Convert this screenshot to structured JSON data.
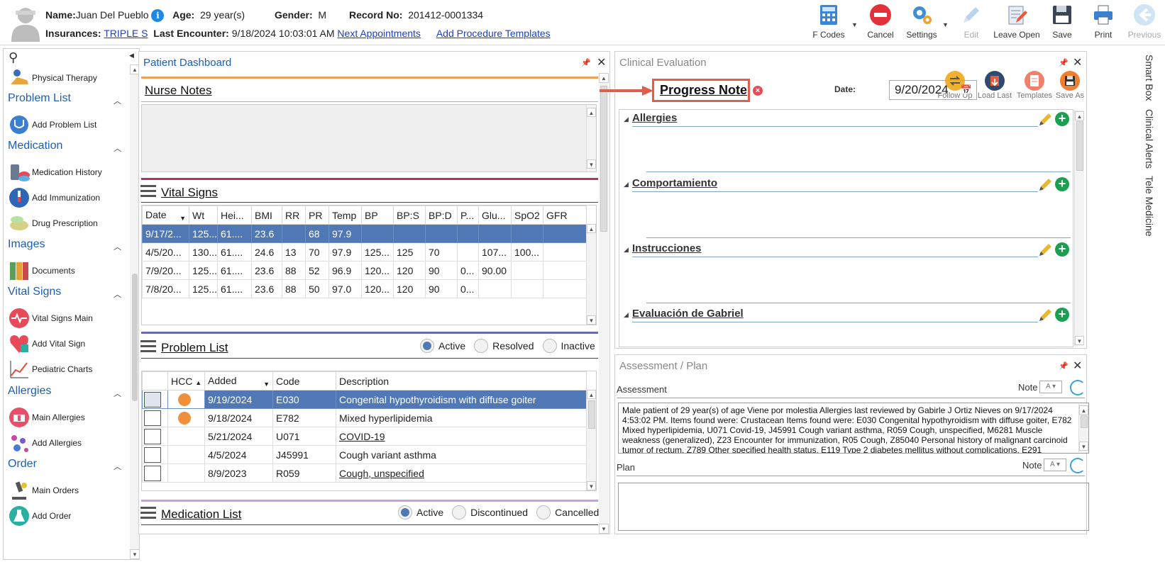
{
  "patient": {
    "name_label": "Name:",
    "name": "Juan Del Pueblo",
    "age_label": "Age:",
    "age": "29 year(s)",
    "gender_label": "Gender:",
    "gender": "M",
    "record_label": "Record No:",
    "record": "201412-0001334",
    "insurances_label": "Insurances:",
    "insurance": "TRIPLE S",
    "last_encounter_label": "Last Encounter:",
    "last_encounter": "9/18/2024 10:03:01 AM",
    "next_appointments": "Next Appointments",
    "add_procedure_templates": "Add Procedure Templates"
  },
  "toolbar": {
    "fcodes": "F Codes",
    "cancel": "Cancel",
    "settings": "Settings",
    "edit": "Edit",
    "leave_open": "Leave Open",
    "save": "Save",
    "print": "Print",
    "previous": "Previous"
  },
  "nav": {
    "physical_therapy": "Physical Therapy",
    "problem_list": "Problem List",
    "add_problem_list": "Add Problem List",
    "medication": "Medication",
    "medication_history": "Medication History",
    "add_immunization": "Add Immunization",
    "drug_prescription": "Drug Prescription",
    "images": "Images",
    "documents": "Documents",
    "vital_signs": "Vital Signs",
    "vital_signs_main": "Vital Signs Main",
    "add_vital_sign": "Add Vital Sign",
    "pediatric_charts": "Pediatric Charts",
    "allergies": "Allergies",
    "main_allergies": "Main Allergies",
    "add_allergies": "Add Allergies",
    "order": "Order",
    "main_orders": "Main Orders",
    "add_order": "Add Order"
  },
  "dashboard": {
    "title": "Patient Dashboard",
    "nurse_notes": "Nurse Notes",
    "vital_signs": "Vital Signs",
    "vital_cols": [
      "Date",
      "Wt",
      "Hei...",
      "BMI",
      "RR",
      "PR",
      "Temp",
      "BP",
      "BP:S",
      "BP:D",
      "P...",
      "Glu...",
      "SpO2",
      "GFR"
    ],
    "vital_rows": [
      [
        "9/17/2...",
        "125...",
        "61....",
        "23.6",
        "",
        "68",
        "97.9",
        "",
        "",
        "",
        "",
        "",
        "",
        ""
      ],
      [
        "4/5/20...",
        "130...",
        "61....",
        "24.6",
        "13",
        "70",
        "97.9",
        "125...",
        "125",
        "70",
        "",
        "107...",
        "100...",
        ""
      ],
      [
        "7/9/20...",
        "125...",
        "61....",
        "23.6",
        "88",
        "52",
        "96.9",
        "120...",
        "120",
        "90",
        "0...",
        "90.00",
        "",
        ""
      ],
      [
        "7/8/20...",
        "125...",
        "61....",
        "23.6",
        "88",
        "50",
        "97.0",
        "120...",
        "120",
        "90",
        "0...",
        "",
        "",
        ""
      ]
    ],
    "problem_list": "Problem List",
    "problem_radios": [
      "Active",
      "Resolved",
      "Inactive"
    ],
    "problem_cols": [
      "",
      "HCC",
      "Added",
      "Code",
      "Description"
    ],
    "problem_rows": [
      {
        "added": "9/19/2024",
        "code": "E030",
        "desc": "Congenital hypothyroidism with diffuse goiter",
        "hcc": true
      },
      {
        "added": "9/18/2024",
        "code": "E782",
        "desc": "Mixed hyperlipidemia",
        "hcc": true
      },
      {
        "added": "5/21/2024",
        "code": "U071",
        "desc": "COVID-19",
        "hcc": false
      },
      {
        "added": "4/5/2024",
        "code": "J45991",
        "desc": "Cough variant asthma",
        "hcc": false
      },
      {
        "added": "8/9/2023",
        "code": "R059",
        "desc": "Cough, unspecified",
        "hcc": false
      }
    ],
    "medication_list": "Medication List",
    "medication_radios": [
      "Active",
      "Discontinued",
      "Cancelled"
    ]
  },
  "clinical": {
    "title": "Clinical Evaluation",
    "progress_note": "Progress Note",
    "date_label": "Date:",
    "date": "9/20/2024",
    "follow_up": "Follow Up",
    "load_last": "Load Last",
    "templates": "Templates",
    "save_as": "Save As",
    "sections": [
      "Allergies",
      "Comportamiento",
      "Instrucciones",
      "Evaluación de Gabriel"
    ]
  },
  "assessment": {
    "title": "Assessment / Plan",
    "assessment_label": "Assessment",
    "note_label": "Note",
    "assessment_text": "Male patient of 29 year(s) of age Viene por molestia     Allergies last reviewed by Gabirle J Ortiz Nieves on 9/17/2024 4:53:02 PM.    Items found were:  Crustacean  Items found were:  E030 Congenital hypothyroidism with diffuse goiter, E782 Mixed hyperlipidemia, U071 Covid-19, J45991 Cough variant asthma, R059 Cough, unspecified, M6281 Muscle weakness (generalized), Z23 Encounter for immunization, R05 Cough, Z85040 Personal history of malignant carcinoid tumor of rectum, Z789 Other specified health status, E119 Type 2 diabetes mellitus without complications, E291",
    "plan_label": "Plan"
  },
  "sidetabs": [
    "Smart Box",
    "Clinical Alerts",
    "Tele Medicine"
  ],
  "colors": {
    "accent": "#1a5fb4",
    "selected_row": "#4f78b5",
    "nurse_line": "#f0a050",
    "vital_line": "#b0385a",
    "problem_line": "#6a6ab4",
    "med_line": "#c8a0e0",
    "hcc_dot": "#f0903a",
    "annotation_red": "#e15d4d"
  }
}
